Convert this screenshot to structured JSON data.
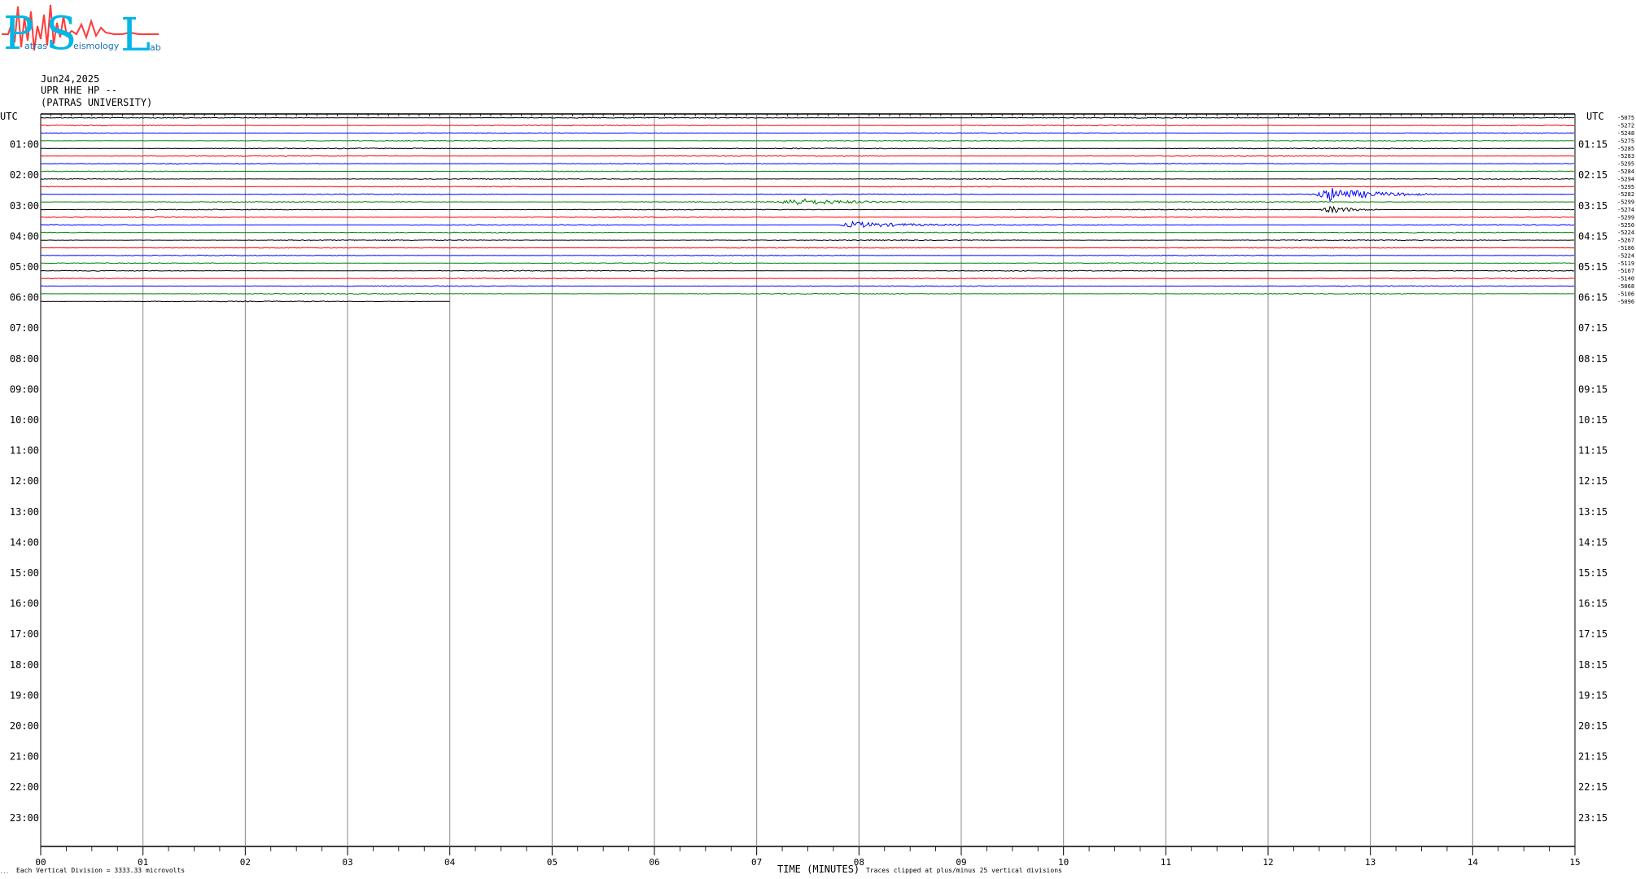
{
  "logo": {
    "letters": [
      "P",
      "S",
      "L"
    ],
    "small_words": [
      "atras",
      "eismology",
      "ab"
    ],
    "colors": {
      "letters": "#00b7e6",
      "wave": "#ff3b3b",
      "words": "#1a6fb3"
    }
  },
  "header": {
    "date": "Jun24,2025",
    "station": "UPR HHE HP --",
    "institution": "(PATRAS UNIVERSITY)"
  },
  "axis": {
    "left_header": "UTC",
    "right_header": "UTC",
    "x_title": "TIME (MINUTES)",
    "footnote_left": "Each Vertical Division = 3333.33 microvolts",
    "footnote_right": "Traces clipped at plus/minus 25 vertical divisions",
    "corner_mark": "..."
  },
  "chart_data": {
    "type": "line",
    "title": "",
    "xlabel": "TIME (MINUTES)",
    "xlim": [
      0,
      15
    ],
    "x_ticks": [
      "00",
      "01",
      "02",
      "03",
      "04",
      "05",
      "06",
      "07",
      "08",
      "09",
      "10",
      "11",
      "12",
      "13",
      "14",
      "15"
    ],
    "left_hour_labels": [
      "01:00",
      "02:00",
      "03:00",
      "04:00",
      "05:00",
      "06:00",
      "07:00",
      "08:00",
      "09:00",
      "10:00",
      "11:00",
      "12:00",
      "13:00",
      "14:00",
      "15:00",
      "16:00",
      "17:00",
      "18:00",
      "19:00",
      "20:00",
      "21:00",
      "22:00",
      "23:00"
    ],
    "right_hour_labels": [
      "01:15",
      "02:15",
      "03:15",
      "04:15",
      "05:15",
      "06:15",
      "07:15",
      "08:15",
      "09:15",
      "10:15",
      "11:15",
      "12:15",
      "13:15",
      "14:15",
      "15:15",
      "16:15",
      "17:15",
      "18:15",
      "19:15",
      "20:15",
      "21:15",
      "22:15",
      "23:15"
    ],
    "trace_colors": [
      "#000000",
      "#ff0000",
      "#0000ff",
      "#008000"
    ],
    "trace_count": 25,
    "last_trace_end_minute": 4.0,
    "right_trace_values": [
      "-5075",
      "-5272",
      "-5248",
      "-5275",
      "-5285",
      "-5283",
      "-5295",
      "-5284",
      "-5294",
      "-5295",
      "-5282",
      "-5299",
      "-5274",
      "-5299",
      "-5250",
      "-5224",
      "-5267",
      "-5186",
      "-5224",
      "-5119",
      "-5167",
      "-5140",
      "-5068",
      "-5106",
      "-5096"
    ],
    "events": [
      {
        "trace": 10,
        "minute": 12.55,
        "duration": 1.0,
        "amplitude": 2.6
      },
      {
        "trace": 11,
        "minute": 7.3,
        "duration": 1.2,
        "amplitude": 1.3
      },
      {
        "trace": 12,
        "minute": 12.6,
        "duration": 0.5,
        "amplitude": 1.5
      },
      {
        "trace": 14,
        "minute": 7.9,
        "duration": 1.2,
        "amplitude": 1.2
      }
    ]
  }
}
